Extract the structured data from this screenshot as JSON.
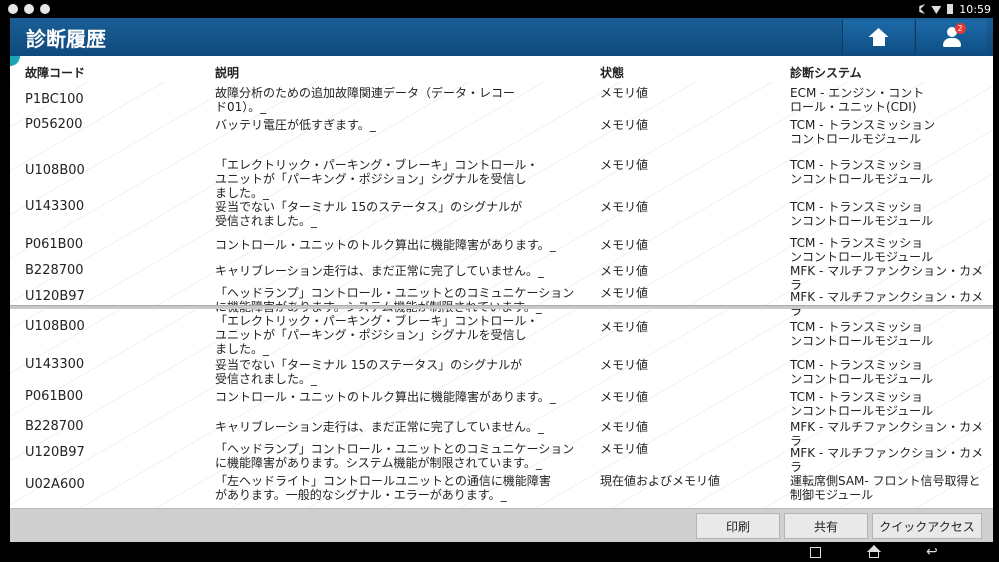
{
  "status_bar": {
    "time": "10:59"
  },
  "header": {
    "title": "診断履歴",
    "badge_count": "2"
  },
  "columns": {
    "code": "故障コード",
    "description": "説明",
    "state": "状態",
    "system": "診断システム"
  },
  "panel1": [
    {
      "code": "P1BC100",
      "desc": "故障分析のための追加故障関連データ（データ・レコー\nド01）。_",
      "state": "メモリ値",
      "system": "ECM - エンジン・コント\nロール・ユニット(CDI)"
    },
    {
      "code": "P056200",
      "desc": "バッテリ電圧が低すぎます。_",
      "state": "メモリ値",
      "system": "TCM - トランスミッション\nコントロールモジュール"
    },
    {
      "code": "U108B00",
      "desc": "「エレクトリック・パーキング・ブレーキ」コントロール・\nユニットが「パーキング・ポジション」シグナルを受信し\nました。_",
      "state": "メモリ値",
      "system": "TCM - トランスミッショ\nンコントロールモジュール"
    },
    {
      "code": "U143300",
      "desc": "妥当でない「ターミナル 15のステータス」のシグナルが\n受信されました。_",
      "state": "メモリ値",
      "system": "TCM - トランスミッショ\nンコントロールモジュール"
    },
    {
      "code": "P061B00",
      "desc": "コントロール・ユニットのトルク算出に機能障害があります。_",
      "state": "メモリ値",
      "system": "TCM - トランスミッショ\nンコントロールモジュール"
    },
    {
      "code": "B228700",
      "desc": "キャリブレーション走行は、まだ正常に完了していません。_",
      "state": "メモリ値",
      "system": "MFK - マルチファンクション・カメラ"
    },
    {
      "code": "U120B97",
      "desc": "「ヘッドランプ」コントロール・ユニットとのコミュニケーション\nに機能障害があります。システム機能が制限されています。_",
      "state": "メモリ値",
      "system": "MFK - マルチファンクション・カメラ"
    }
  ],
  "panel2": [
    {
      "code": "U108B00",
      "desc": "「エレクトリック・パーキング・ブレーキ」コントロール・\nユニットが「パーキング・ポジション」シグナルを受信し\nました。_",
      "state": "メモリ値",
      "system": "TCM - トランスミッショ\nンコントロールモジュール"
    },
    {
      "code": "U143300",
      "desc": "妥当でない「ターミナル 15のステータス」のシグナルが\n受信されました。_",
      "state": "メモリ値",
      "system": "TCM - トランスミッショ\nンコントロールモジュール"
    },
    {
      "code": "P061B00",
      "desc": "コントロール・ユニットのトルク算出に機能障害があります。_",
      "state": "メモリ値",
      "system": "TCM - トランスミッショ\nンコントロールモジュール"
    },
    {
      "code": "B228700",
      "desc": "キャリブレーション走行は、まだ正常に完了していません。_",
      "state": "メモリ値",
      "system": "MFK - マルチファンクション・カメラ"
    },
    {
      "code": "U120B97",
      "desc": "「ヘッドランプ」コントロール・ユニットとのコミュニケーション\nに機能障害があります。システム機能が制限されています。_",
      "state": "メモリ値",
      "system": "MFK - マルチファンクション・カメラ"
    },
    {
      "code": "U02A600",
      "desc": "「左ヘッドライト」コントロールユニットとの通信に機能障害\nがあります。一般的なシグナル・エラーがあります。_",
      "state": "現在値およびメモリ値",
      "system": "運転席側SAM- フロント信号取得と\n制御モジュール"
    }
  ],
  "footer": {
    "print": "印刷",
    "share": "共有",
    "quick_access": "クイックアクセス"
  },
  "nav": {
    "back": "↩"
  }
}
